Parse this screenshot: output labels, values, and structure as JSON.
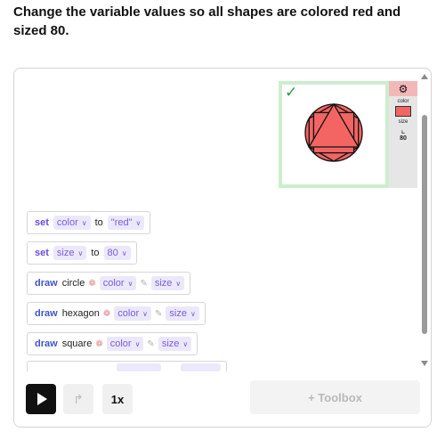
{
  "instructions": "Change the variable values so all shapes are colored red and sized 80.",
  "preview": {
    "check_icon": "check-icon",
    "fill_color": "#f26563",
    "border_color": "#cdeecd"
  },
  "variables_panel": {
    "settings_icon": "gear-icon",
    "color_label": "color",
    "color_value": "#f26563",
    "size_label": "size",
    "size_value": "80"
  },
  "code": {
    "set_color": {
      "kw": "set",
      "var": "color",
      "to": "to",
      "value": "\"red\""
    },
    "set_size": {
      "kw": "set",
      "var": "size",
      "to": "to",
      "value": "80"
    },
    "draw_circle": {
      "kw": "draw",
      "shape": "circle",
      "color": "color",
      "size": "size"
    },
    "draw_hexagon": {
      "kw": "draw",
      "shape": "hexagon",
      "color": "color",
      "size": "size"
    },
    "draw_square": {
      "kw": "draw",
      "shape": "square",
      "color": "color",
      "size": "size"
    }
  },
  "toolbar": {
    "play_icon": "play-icon",
    "step_icon": "step-icon",
    "speed_label": "1x",
    "toolbox_label": "+ Toolbox"
  }
}
